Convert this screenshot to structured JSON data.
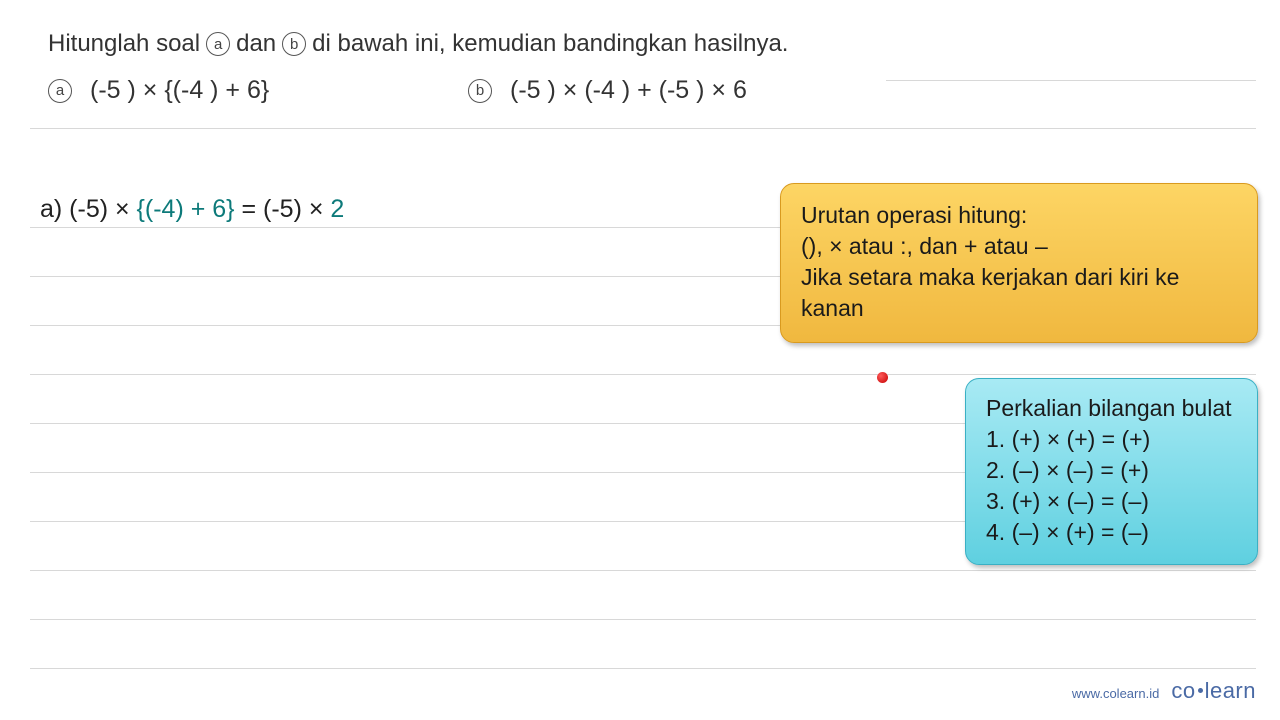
{
  "instruction": {
    "part1": "Hitunglah soal",
    "label_a": "a",
    "part2": "dan",
    "label_b": "b",
    "part3": "di bawah ini, kemudian bandingkan hasilnya."
  },
  "problems": {
    "a": {
      "label": "a",
      "expr": "(-5 ) × {(-4 ) + 6}"
    },
    "b": {
      "label": "b",
      "expr": "(-5 ) × (-4 ) + (-5 ) × 6"
    }
  },
  "work": {
    "prefix": "a) (-5) × ",
    "teal1": "{(-4) + 6}",
    "mid": "  = (-5) × ",
    "teal2": "2"
  },
  "callout_yellow": {
    "line1": "Urutan operasi hitung:",
    "line2": "(), × atau :, dan + atau –",
    "line3": "Jika setara maka kerjakan dari kiri ke kanan"
  },
  "callout_cyan": {
    "title": "Perkalian bilangan bulat",
    "r1": "1. (+) × (+) = (+)",
    "r2": "2. (–) × (–) = (+)",
    "r3": "3. (+) × (–) = (–)",
    "r4": "4. (–) × (+) = (–)"
  },
  "footer": {
    "url": "www.colearn.id",
    "logo_co": "co",
    "logo_learn": "learn"
  }
}
